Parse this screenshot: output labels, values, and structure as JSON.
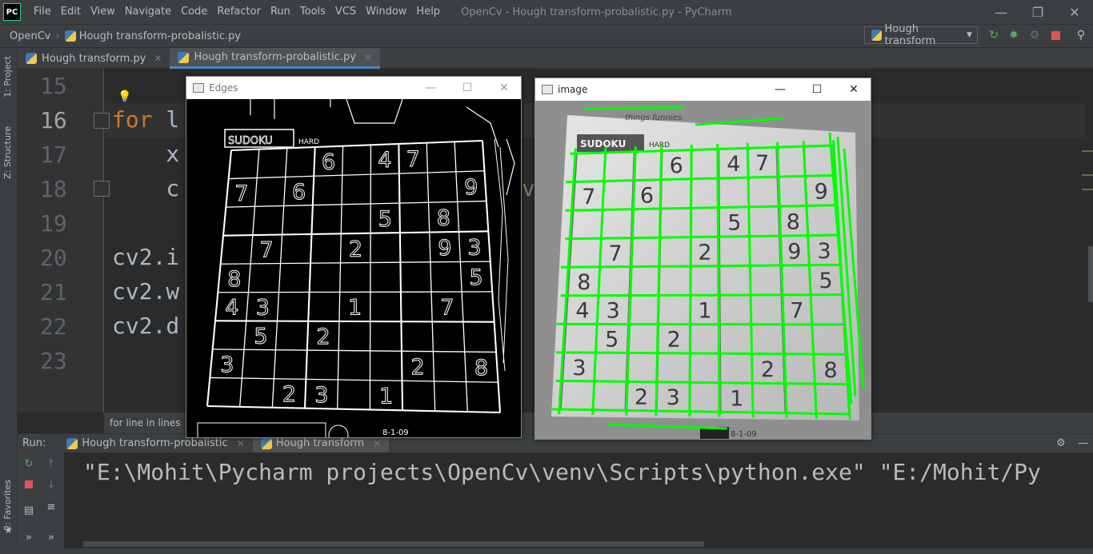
{
  "app": {
    "logo_text": "PC",
    "window_title": "OpenCv - Hough transform-probalistic.py - PyCharm",
    "menu": [
      "File",
      "Edit",
      "View",
      "Navigate",
      "Code",
      "Refactor",
      "Run",
      "Tools",
      "VCS",
      "Window",
      "Help"
    ]
  },
  "navbar": {
    "project": "OpenCv",
    "file": "Hough transform-probalistic.py",
    "run_config": "Hough transform"
  },
  "left_stripe": {
    "project": "1: Project",
    "structure": "Z: Structure",
    "favorites": "2: Favorites"
  },
  "editor_tabs": [
    {
      "label": "Hough transform.py"
    },
    {
      "label": "Hough transform-probalistic.py"
    }
  ],
  "editor": {
    "line_numbers": [
      "15",
      "16",
      "17",
      "18",
      "19",
      "20",
      "21",
      "22",
      "23"
    ],
    "lines": [
      {
        "kw": "",
        "text": ""
      },
      {
        "kw": "for",
        "text": " l"
      },
      {
        "kw": "",
        "text": "    x"
      },
      {
        "kw": "",
        "text": "    c"
      },
      {
        "kw": "",
        "text": ""
      },
      {
        "kw": "",
        "text": "cv2.i"
      },
      {
        "kw": "",
        "text": "cv2.w"
      },
      {
        "kw": "",
        "text": "cv2.d"
      },
      {
        "kw": "",
        "text": ""
      }
    ],
    "breadcrumb": "for line in lines"
  },
  "run": {
    "label": "Run:",
    "tabs": [
      {
        "label": "Hough transform-probalistic"
      },
      {
        "label": "Hough transform"
      }
    ],
    "console": "\"E:\\Mohit\\Pycharm projects\\OpenCv\\venv\\Scripts\\python.exe\" \"E:/Mohit/Py"
  },
  "cv_windows": {
    "edges": {
      "title": "Edges",
      "header_text": "SUDOKU",
      "hard": "HARD",
      "date": "8-1-09"
    },
    "image": {
      "title": "image",
      "header_text": "SUDOKU",
      "hard": "HARD",
      "snippet": "things funnies.",
      "date": "8-1-09"
    }
  },
  "sudoku": {
    "cells": [
      {
        "r": 0,
        "c": 3,
        "v": "6"
      },
      {
        "r": 0,
        "c": 5,
        "v": "4"
      },
      {
        "r": 0,
        "c": 6,
        "v": "7"
      },
      {
        "r": 1,
        "c": 0,
        "v": "7"
      },
      {
        "r": 1,
        "c": 2,
        "v": "6"
      },
      {
        "r": 1,
        "c": 8,
        "v": "9"
      },
      {
        "r": 2,
        "c": 5,
        "v": "5"
      },
      {
        "r": 2,
        "c": 7,
        "v": "8"
      },
      {
        "r": 3,
        "c": 1,
        "v": "7"
      },
      {
        "r": 3,
        "c": 4,
        "v": "2"
      },
      {
        "r": 3,
        "c": 7,
        "v": "9"
      },
      {
        "r": 3,
        "c": 8,
        "v": "3"
      },
      {
        "r": 4,
        "c": 0,
        "v": "8"
      },
      {
        "r": 4,
        "c": 8,
        "v": "5"
      },
      {
        "r": 5,
        "c": 0,
        "v": "4"
      },
      {
        "r": 5,
        "c": 1,
        "v": "3"
      },
      {
        "r": 5,
        "c": 4,
        "v": "1"
      },
      {
        "r": 5,
        "c": 7,
        "v": "7"
      },
      {
        "r": 6,
        "c": 1,
        "v": "5"
      },
      {
        "r": 6,
        "c": 3,
        "v": "2"
      },
      {
        "r": 7,
        "c": 0,
        "v": "3"
      },
      {
        "r": 7,
        "c": 6,
        "v": "2"
      },
      {
        "r": 7,
        "c": 8,
        "v": "8"
      },
      {
        "r": 8,
        "c": 2,
        "v": "2"
      },
      {
        "r": 8,
        "c": 3,
        "v": "3"
      },
      {
        "r": 8,
        "c": 5,
        "v": "1"
      }
    ]
  },
  "colors": {
    "keyword": "#cc7832",
    "hough_line": "#00ff00",
    "accent": "#4a88c7"
  }
}
